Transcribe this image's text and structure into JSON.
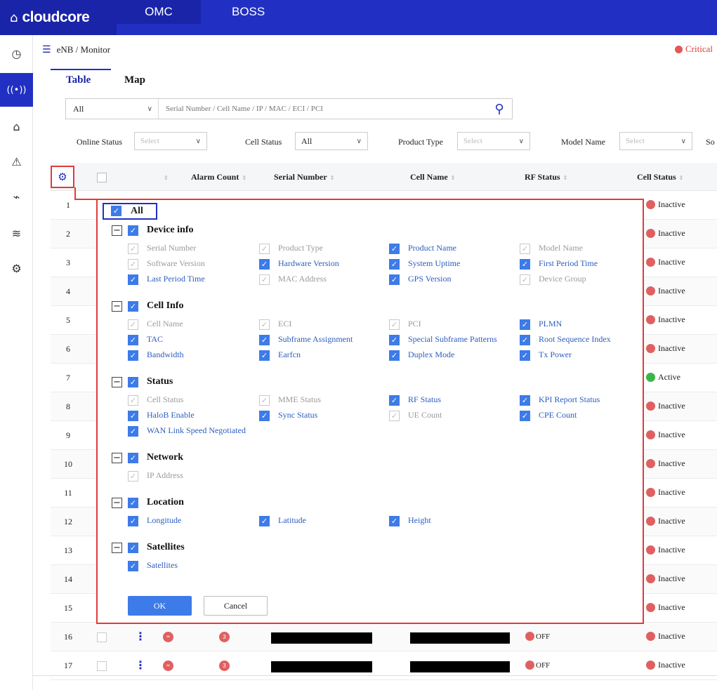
{
  "topbar": {
    "brand": "cloudcore",
    "nav": [
      "OMC",
      "BOSS"
    ]
  },
  "sidebar": {
    "icons": [
      "dashboard-icon",
      "antenna-icon",
      "router-icon",
      "alarm-icon",
      "chart-icon",
      "layers-icon",
      "settings-icon"
    ]
  },
  "breadcrumb": {
    "text": "eNB / Monitor"
  },
  "alarm": {
    "critical_label": "Critical"
  },
  "tabs": {
    "table": "Table",
    "map": "Map"
  },
  "search": {
    "scope": "All",
    "placeholder": "Serial Number / Cell Name / IP / MAC / ECI / PCI"
  },
  "filters": {
    "online_status": {
      "label": "Online Status",
      "value": "Select"
    },
    "cell_status": {
      "label": "Cell Status",
      "value": "All"
    },
    "product_type": {
      "label": "Product Type",
      "value": "Select"
    },
    "model_name": {
      "label": "Model Name",
      "value": "Select"
    },
    "more_label": "So"
  },
  "table": {
    "columns": [
      "Alarm Count",
      "Serial Number",
      "Cell Name",
      "RF Status",
      "Cell Status"
    ],
    "rows": [
      {
        "num": "1",
        "cell_status": "Inactive"
      },
      {
        "num": "2",
        "cell_status": "Inactive"
      },
      {
        "num": "3",
        "cell_status": "Inactive"
      },
      {
        "num": "4",
        "cell_status": "Inactive"
      },
      {
        "num": "5",
        "cell_status": "Inactive"
      },
      {
        "num": "6",
        "cell_status": "Inactive"
      },
      {
        "num": "7",
        "cell_status": "Active"
      },
      {
        "num": "8",
        "cell_status": "Inactive"
      },
      {
        "num": "9",
        "cell_status": "Inactive"
      },
      {
        "num": "10",
        "cell_status": "Inactive"
      },
      {
        "num": "11",
        "cell_status": "Inactive"
      },
      {
        "num": "12",
        "cell_status": "Inactive"
      },
      {
        "num": "13",
        "cell_status": "Inactive"
      },
      {
        "num": "14",
        "cell_status": "Inactive"
      },
      {
        "num": "15",
        "cell_status": "Inactive"
      },
      {
        "num": "16",
        "cell_status": "Inactive",
        "alarm_badge": "3",
        "rf": "OFF"
      },
      {
        "num": "17",
        "cell_status": "Inactive",
        "alarm_badge": "3",
        "rf": "OFF"
      }
    ]
  },
  "column_panel": {
    "all_label": "All",
    "sections": [
      {
        "title": "Device info",
        "options": [
          {
            "label": "Serial Number",
            "state": "off"
          },
          {
            "label": "Product Type",
            "state": "off"
          },
          {
            "label": "Product Name",
            "state": "on"
          },
          {
            "label": "Model Name",
            "state": "off"
          },
          {
            "label": "Software Version",
            "state": "off"
          },
          {
            "label": "Hardware Version",
            "state": "on"
          },
          {
            "label": "System Uptime",
            "state": "on"
          },
          {
            "label": "First Period Time",
            "state": "on"
          },
          {
            "label": "Last Period Time",
            "state": "on"
          },
          {
            "label": "MAC Address",
            "state": "off"
          },
          {
            "label": "GPS Version",
            "state": "on"
          },
          {
            "label": "Device Group",
            "state": "off"
          }
        ]
      },
      {
        "title": "Cell Info",
        "options": [
          {
            "label": "Cell Name",
            "state": "off"
          },
          {
            "label": "ECI",
            "state": "off"
          },
          {
            "label": "PCI",
            "state": "off"
          },
          {
            "label": "PLMN",
            "state": "on"
          },
          {
            "label": "TAC",
            "state": "on"
          },
          {
            "label": "Subframe Assignment",
            "state": "on"
          },
          {
            "label": "Special Subframe Patterns",
            "state": "on"
          },
          {
            "label": "Root Sequence Index",
            "state": "on"
          },
          {
            "label": "Bandwidth",
            "state": "on"
          },
          {
            "label": "Earfcn",
            "state": "on"
          },
          {
            "label": "Duplex Mode",
            "state": "on"
          },
          {
            "label": "Tx Power",
            "state": "on"
          }
        ]
      },
      {
        "title": "Status",
        "options": [
          {
            "label": "Cell Status",
            "state": "off"
          },
          {
            "label": "MME Status",
            "state": "off"
          },
          {
            "label": "RF Status",
            "state": "on"
          },
          {
            "label": "KPI Report Status",
            "state": "on"
          },
          {
            "label": "HaloB Enable",
            "state": "on"
          },
          {
            "label": "Sync Status",
            "state": "on"
          },
          {
            "label": "UE Count",
            "state": "off"
          },
          {
            "label": "CPE Count",
            "state": "on"
          },
          {
            "label": "WAN Link Speed Negotiated",
            "state": "on"
          }
        ]
      },
      {
        "title": "Network",
        "options": [
          {
            "label": "IP Address",
            "state": "off"
          }
        ]
      },
      {
        "title": "Location",
        "options": [
          {
            "label": "Longitude",
            "state": "on"
          },
          {
            "label": "Latitude",
            "state": "on"
          },
          {
            "label": "Height",
            "state": "on"
          }
        ]
      },
      {
        "title": "Satellites",
        "options": [
          {
            "label": "Satellites",
            "state": "on"
          }
        ]
      }
    ],
    "ok_label": "OK",
    "cancel_label": "Cancel"
  }
}
